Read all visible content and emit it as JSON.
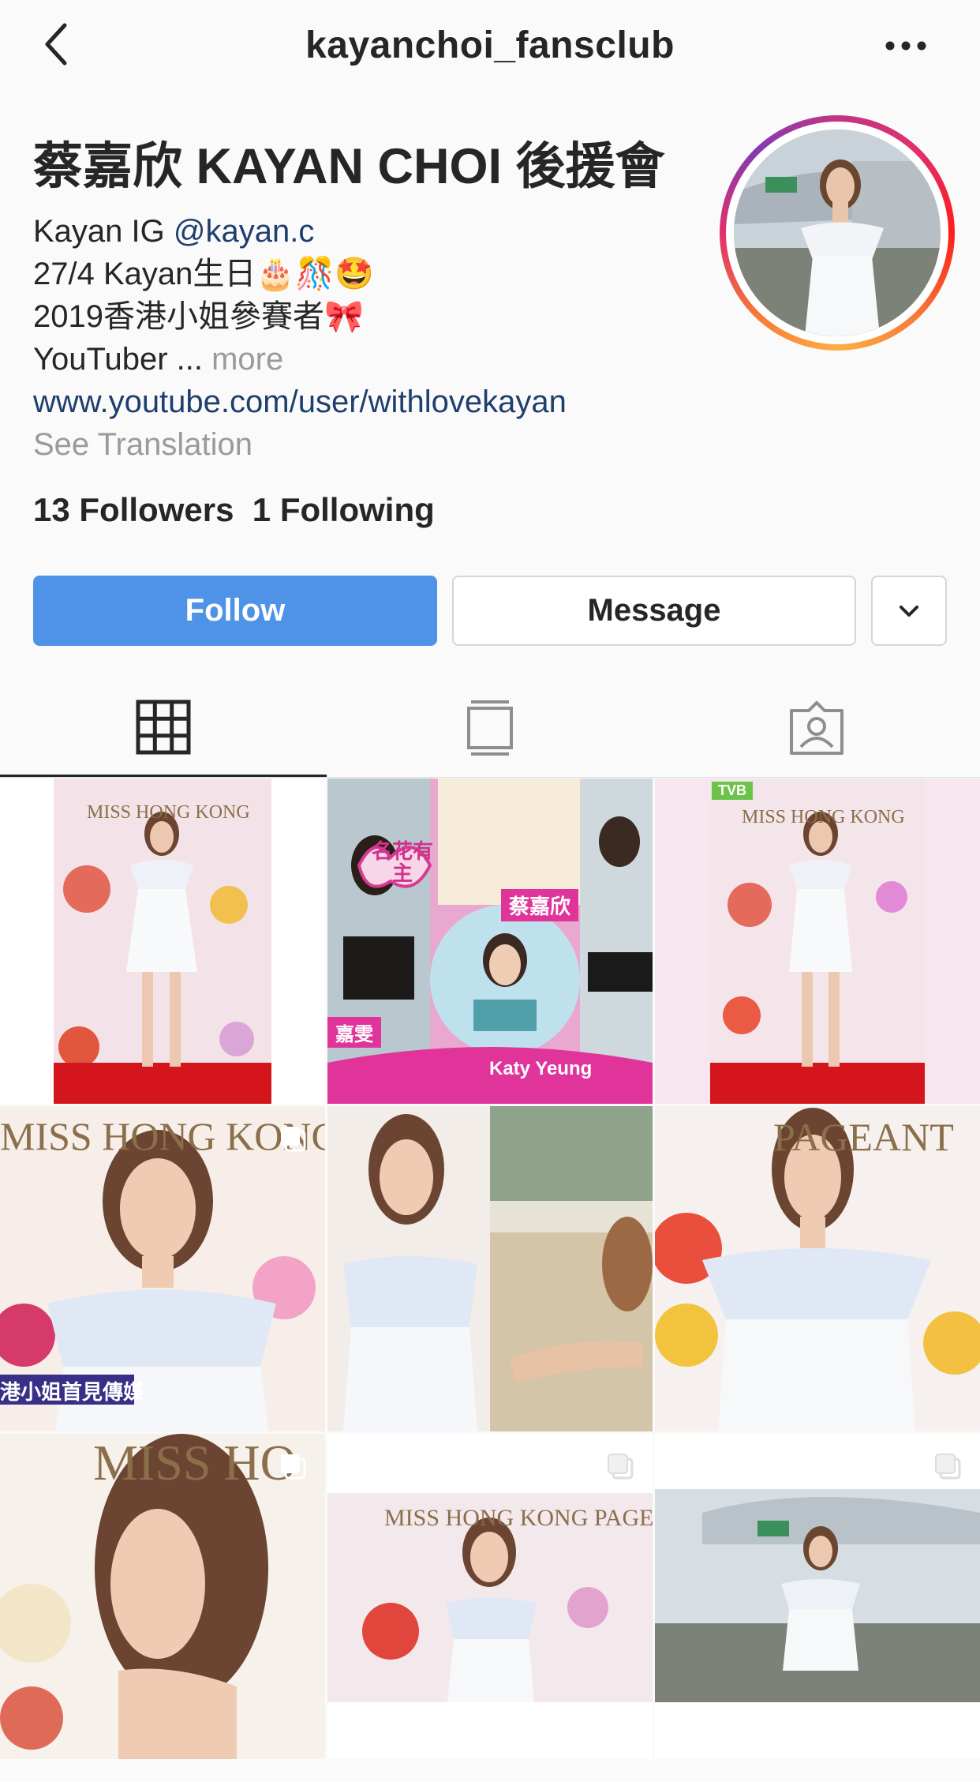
{
  "header": {
    "username": "kayanchoi_fansclub",
    "back_icon": "chevron-left-icon",
    "more_icon": "ellipsis-icon"
  },
  "profile": {
    "display_name": "蔡嘉欣 KAYAN CHOI 後援會",
    "bio": {
      "line1_prefix": "Kayan IG ",
      "line1_mention": "@kayan.c",
      "line2": "27/4 Kayan生日🎂🎊🤩",
      "line3": "2019香港小姐參賽者🎀",
      "line4_text": "YouTuber ... ",
      "line4_more": "more",
      "website": "www.youtube.com/user/withlovekayan",
      "translate": "See Translation"
    },
    "followers_count": "13",
    "followers_label": "Followers",
    "following_count": "1",
    "following_label": "Following"
  },
  "actions": {
    "follow_label": "Follow",
    "message_label": "Message",
    "dropdown_icon": "chevron-down-icon"
  },
  "tabs": [
    {
      "name": "grid-icon",
      "active": true
    },
    {
      "name": "igtv-icon",
      "active": false
    },
    {
      "name": "tagged-icon",
      "active": false
    }
  ],
  "posts": [
    {
      "overlay": "MISS HONG KONG",
      "multiple": false
    },
    {
      "overlay": "名花有主",
      "caption1": "蔡嘉欣",
      "caption2": "Katy Yeung",
      "caption3": "嘉雯",
      "multiple": false
    },
    {
      "overlay": "MISS HONG KONG",
      "badge": "TVB",
      "multiple": false
    },
    {
      "overlay": "MISS HONG KONG PAGE",
      "caption1": "港小姐首見傳媒",
      "multiple": true
    },
    {
      "overlay": "",
      "multiple": false
    },
    {
      "overlay": "PAGEANT",
      "multiple": false
    },
    {
      "overlay": "MISS HO",
      "multiple": true
    },
    {
      "overlay": "MISS HONG KONG PAGE",
      "multiple": true
    },
    {
      "overlay": "",
      "multiple": true
    }
  ],
  "colors": {
    "follow_blue": "#4f93e9",
    "link_blue": "#1f3e6e",
    "text": "#262626",
    "muted": "#9a9a9a",
    "background": "#fafafa"
  }
}
